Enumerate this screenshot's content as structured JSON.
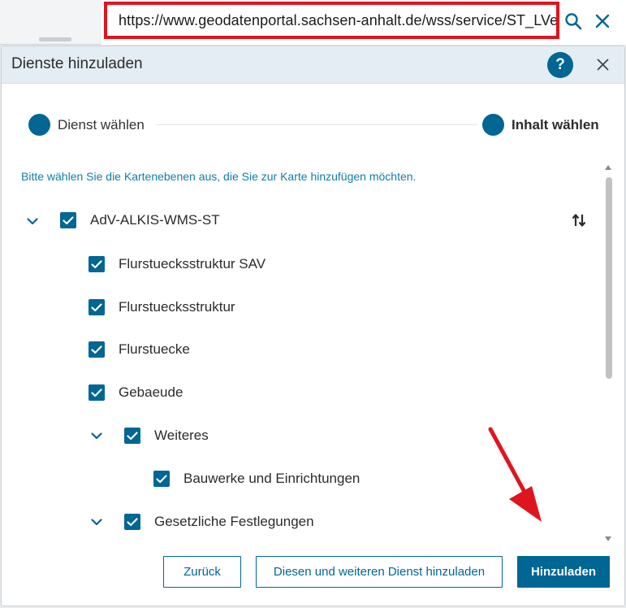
{
  "url_bar": {
    "value": "https://www.geodatenportal.sachsen-anhalt.de/wss/service/ST_LVermGeo_ALKIS_WMS_AdV_konform_App/guest"
  },
  "dialog": {
    "title": "Dienste hinzuladen",
    "help_label": "?",
    "steps": [
      {
        "label": "Dienst wählen"
      },
      {
        "label": "Inhalt wählen"
      }
    ],
    "instruction": "Bitte wählen Sie die Kartenebenen aus, die Sie zur Karte hinzufügen möchten.",
    "tree": [
      {
        "label": "AdV-ALKIS-WMS-ST",
        "checked": true,
        "expanded": true
      },
      {
        "label": "Flurstuecksstruktur SAV",
        "checked": true
      },
      {
        "label": "Flurstuecksstruktur",
        "checked": true
      },
      {
        "label": "Flurstuecke",
        "checked": true
      },
      {
        "label": "Gebaeude",
        "checked": true
      },
      {
        "label": "Weiteres",
        "checked": true,
        "expanded": true
      },
      {
        "label": "Bauwerke und Einrichtungen",
        "checked": true
      },
      {
        "label": "Gesetzliche Festlegungen",
        "checked": true,
        "expanded": true
      }
    ],
    "buttons": {
      "back": "Zurück",
      "add_more": "Diesen und weiteren Dienst hinzuladen",
      "add": "Hinzuladen"
    }
  },
  "colors": {
    "accent": "#006693",
    "header_bg": "#e4edf3",
    "annotation": "#e0141e"
  }
}
